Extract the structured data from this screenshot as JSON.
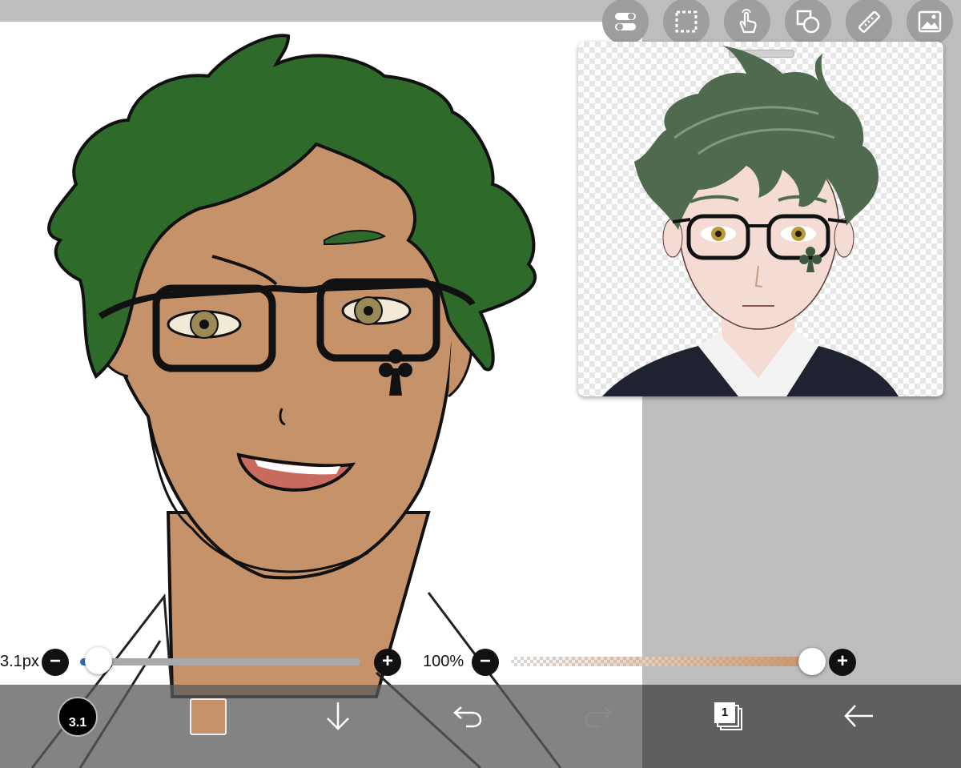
{
  "toolbar": {
    "tools": [
      {
        "name": "toggle-icon"
      },
      {
        "name": "selection-icon"
      },
      {
        "name": "touch-hand-icon"
      },
      {
        "name": "shapes-icon"
      },
      {
        "name": "ruler-icon"
      },
      {
        "name": "image-icon"
      }
    ]
  },
  "brush_slider": {
    "size_label": "3.1px",
    "minus": "−",
    "plus": "+"
  },
  "opacity_slider": {
    "label": "100%",
    "minus": "−",
    "plus": "+",
    "value": 1.0
  },
  "bottom_bar": {
    "brush_size": "3.1",
    "layer_count": "1",
    "color": "#c6926a"
  },
  "colors": {
    "hair_green": "#2e6b2a",
    "skin": "#c6926a",
    "skin_ref": "#f4dcd4",
    "accent_blue": "#2f6fb7"
  }
}
